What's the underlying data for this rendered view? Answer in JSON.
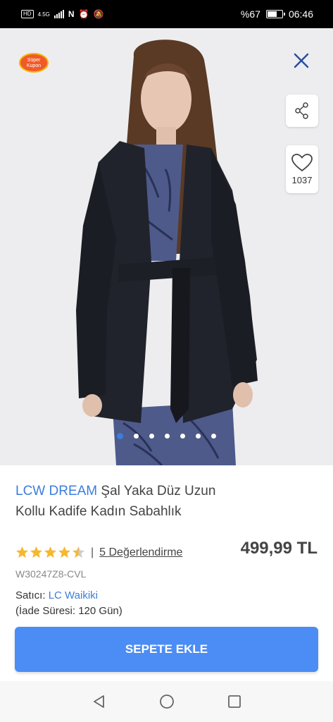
{
  "status_bar": {
    "network": "4.5G",
    "battery": "%67",
    "battery_level": 0.67,
    "time": "06:46"
  },
  "product_image": {
    "coupon_badge": {
      "line1": "Süper",
      "line2": "Kupon"
    },
    "favorite_count": "1037",
    "carousel": {
      "total": 7,
      "active": 0
    }
  },
  "product": {
    "brand": "LCW DREAM",
    "name": "Şal Yaka Düz Uzun Kollu Kadife Kadın Sabahlık",
    "rating": 4.5,
    "separator": "|",
    "reviews_label": "5 Değerlendirme",
    "price": "499,99 TL",
    "sku": "W30247Z8-CVL",
    "seller_label": "Satıcı:",
    "seller_name": "LC Waikiki",
    "return_period": "(İade Süresi: 120 Gün)"
  },
  "cart": {
    "add_label": "SEPETE EKLE",
    "accent": "#4b8cf5"
  },
  "icons": {
    "close": "close-icon",
    "share": "share-icon",
    "favorite": "heart-icon",
    "nav_back": "back-icon",
    "nav_home": "home-icon",
    "nav_recent": "recent-apps-icon"
  }
}
